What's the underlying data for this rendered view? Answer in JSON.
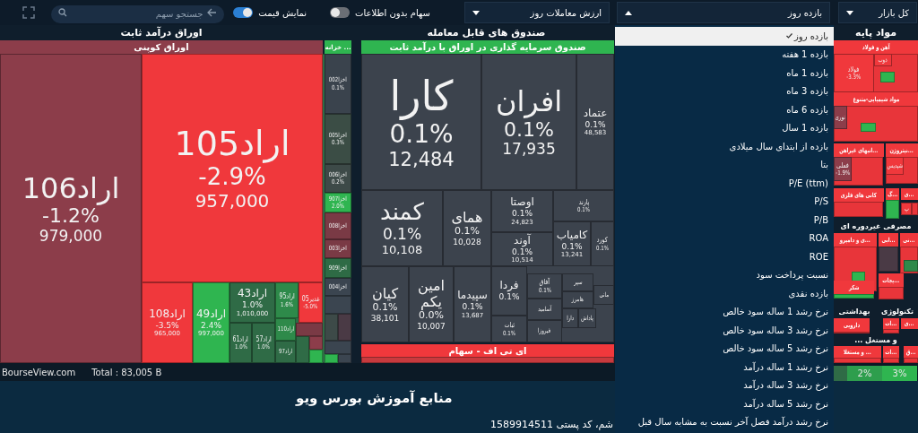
{
  "toolbar": {
    "search": {
      "placeholder": "جستجو سهم"
    },
    "toggles": [
      {
        "label": "سهام بدون اطلاعات",
        "on": false
      },
      {
        "label": "نمایش قیمت",
        "on": true
      }
    ],
    "dropdowns": [
      {
        "value": "کل بازار",
        "expanded": false
      },
      {
        "value": "بازده روز",
        "expanded": true
      },
      {
        "value": "ارزش معاملات روز",
        "expanded": false
      }
    ]
  },
  "sectors": [
    {
      "title": "مواد پایه"
    },
    {
      "title": "صندوق های قابل معامله"
    },
    {
      "title": "اوراق درآمد ثابت"
    },
    {
      "title": "مصرفی غیردوره ای"
    },
    {
      "title": "تکنولوژی"
    },
    {
      "title": "بهداشتی"
    },
    {
      "title": "... و مستغل"
    }
  ],
  "groups": [
    {
      "title": "آهن و فولاد",
      "color": "#f0383c"
    },
    {
      "title": "صندوق سرمایه گذاری در اوراق با درآمد ثابت",
      "color": "#2fb550"
    },
    {
      "title": "خزانه ...",
      "color": "#2fb550"
    },
    {
      "title": "اوراق کوپنی",
      "color": "#8c3d4a"
    },
    {
      "title": "مواد شیمیایی-متنوع",
      "color": "#f0383c"
    },
    {
      "title": "نیتروژن...",
      "color": "#f0383c"
    },
    {
      "title": "انبهای غیراهن...",
      "color": "#f0383c"
    },
    {
      "title": "ی...",
      "color": "#f0383c"
    },
    {
      "title": "گ...",
      "color": "#f0383c"
    },
    {
      "title": "کانی های فلزی",
      "color": "#f0383c"
    },
    {
      "title": "نی...",
      "color": "#f0383c"
    },
    {
      "title": "ابی...",
      "color": "#f0383c"
    },
    {
      "title": "ی و دامپرو...",
      "color": "#f0383c"
    },
    {
      "title": "یجات...",
      "color": "#f0383c"
    },
    {
      "title": "شکر",
      "color": "#f0383c"
    },
    {
      "title": "ی...",
      "color": "#f0383c"
    },
    {
      "title": "ات...",
      "color": "#f0383c"
    },
    {
      "title": "دارویی",
      "color": "#f0383c"
    },
    {
      "title": "ق...",
      "color": "#f0383c"
    },
    {
      "title": "ات...",
      "color": "#f0383c"
    },
    {
      "title": "و مستغلا ...",
      "color": "#f0383c"
    },
    {
      "title": "ای تی اف - سهام",
      "color": "#f0383c"
    }
  ],
  "tiles": [
    {
      "symbol": "ذوب",
      "color": "#f0383c"
    },
    {
      "symbol": "فولاد",
      "change": "-3.3%",
      "color": "#f0383c"
    },
    {
      "symbol": "نوری",
      "color": "#8c3d4a"
    },
    {
      "symbol": "شپدیس",
      "color": "#f0383c"
    },
    {
      "symbol": "فملی",
      "change": "-1.9%",
      "color": "#8c3d4a"
    },
    {
      "symbol": "پ",
      "color": "#f0383c"
    },
    {
      "symbol": "عتماد",
      "change": "0.1%",
      "value": "48,583",
      "color": "#3c434d"
    },
    {
      "symbol": "افران",
      "change": "0.1%",
      "value": "17,935",
      "color": "#3c434d"
    },
    {
      "symbol": "کارا",
      "change": "0.1%",
      "value": "12,484",
      "color": "#3c434d"
    },
    {
      "symbol": "پارند",
      "change": "0.1%",
      "color": "#3c434d"
    },
    {
      "symbol": "کورد",
      "change": "0.1%",
      "color": "#3c434d"
    },
    {
      "symbol": "کامیاب",
      "change": "0.1%",
      "value": "13,241",
      "color": "#3c434d"
    },
    {
      "symbol": "اوصتا",
      "change": "0.1%",
      "value": "24,823",
      "color": "#3c434d"
    },
    {
      "symbol": "آوند",
      "change": "0.1%",
      "value": "10,514",
      "color": "#3c434d"
    },
    {
      "symbol": "همای",
      "change": "0.1%",
      "value": "10,028",
      "color": "#3c434d"
    },
    {
      "symbol": "کمند",
      "change": "0.1%",
      "value": "10,108",
      "color": "#3c434d"
    },
    {
      "symbol": "مانی",
      "color": "#3c434d"
    },
    {
      "symbol": "سپر",
      "color": "#3c434d"
    },
    {
      "symbol": "هامرز",
      "color": "#3c434d"
    },
    {
      "symbol": "پاداش",
      "color": "#3c434d"
    },
    {
      "symbol": "دارا",
      "color": "#3c434d"
    },
    {
      "symbol": "آفاق",
      "change": "0.1%",
      "color": "#3c434d"
    },
    {
      "symbol": "آسامید",
      "color": "#3c434d"
    },
    {
      "symbol": "فیروزا",
      "color": "#3c434d"
    },
    {
      "symbol": "فردا",
      "change": "0.1%",
      "color": "#3c434d"
    },
    {
      "symbol": "ثبات",
      "change": "0.1%",
      "color": "#3c434d"
    },
    {
      "symbol": "سپیدما",
      "change": "0.1%",
      "value": "13,687",
      "color": "#3c434d"
    },
    {
      "symbol": "امین یکم",
      "change": "0.0%",
      "value": "10,007",
      "color": "#3c434d"
    },
    {
      "symbol": "کیان",
      "change": "0.1%",
      "value": "38,101",
      "color": "#3c434d"
    },
    {
      "symbol": "اخزا002",
      "change": "0.1%",
      "color": "#3a434d"
    },
    {
      "symbol": "اخزا005",
      "change": "0.3%",
      "color": "#3b4d45"
    },
    {
      "symbol": "اخزا006",
      "change": "0.2%",
      "color": "#3d4a48"
    },
    {
      "symbol": "اخزا907",
      "change": "2.0%",
      "color": "#2fb550"
    },
    {
      "symbol": "اخزا008",
      "color": "#7a3a45"
    },
    {
      "symbol": "اخزا003",
      "color": "#7a3a45"
    },
    {
      "symbol": "اخزا909",
      "color": "#2e6b45"
    },
    {
      "symbol": "اخزا004",
      "color": "#3b4550"
    },
    {
      "symbol": "اراد105",
      "change": "-2.9%",
      "value": "957,000",
      "color": "#f0383c"
    },
    {
      "symbol": "غدیر05",
      "change": "-5.0%",
      "color": "#f0383c"
    },
    {
      "symbol": "اراد95",
      "change": "1.6%",
      "color": "#2e8a4a"
    },
    {
      "symbol": "اراد110",
      "color": "#2e8a4a"
    },
    {
      "symbol": "اراد97",
      "color": "#2f6b46"
    },
    {
      "symbol": "اراد43",
      "change": "1.0%",
      "value": "1,010,000",
      "color": "#2f6b46"
    },
    {
      "symbol": "اراد57",
      "change": "1.0%",
      "color": "#2f6b46"
    },
    {
      "symbol": "اراد61",
      "change": "1.0%",
      "color": "#2f6b46"
    },
    {
      "symbol": "اراد49",
      "change": "2.4%",
      "value": "997,000",
      "color": "#2fb550"
    },
    {
      "symbol": "اراد108",
      "change": "-3.5%",
      "value": "965,000",
      "color": "#f0383c"
    },
    {
      "symbol": "اراد106",
      "change": "-1.2%",
      "value": "979,000",
      "color": "#8c3d4a"
    }
  ],
  "footer": {
    "site": "BourseView.com",
    "total": "Total : 83,005 B"
  },
  "legend": [
    {
      "label": "3%",
      "color": "#2fb550"
    },
    {
      "label": "2%",
      "color": "#2e9e4d"
    }
  ],
  "metric_menu": {
    "options": [
      {
        "label": "بازده روز",
        "selected": true
      },
      {
        "label": "بازده 1 هفته",
        "selected": false
      },
      {
        "label": "بازده 1 ماه",
        "selected": false
      },
      {
        "label": "بازده 3 ماه",
        "selected": false
      },
      {
        "label": "بازده 6 ماه",
        "selected": false
      },
      {
        "label": "بازده 1 سال",
        "selected": false
      },
      {
        "label": "بازده از ابتدای سال میلادی",
        "selected": false
      },
      {
        "label": "بتا",
        "selected": false
      },
      {
        "label": "P/E (ttm)",
        "selected": false
      },
      {
        "label": "P/S",
        "selected": false
      },
      {
        "label": "P/B",
        "selected": false
      },
      {
        "label": "ROA",
        "selected": false
      },
      {
        "label": "ROE",
        "selected": false
      },
      {
        "label": "نسبت پرداخت سود",
        "selected": false
      },
      {
        "label": "بازده نقدی",
        "selected": false
      },
      {
        "label": "نرخ رشد 1 ساله سود خالص",
        "selected": false
      },
      {
        "label": "نرخ رشد 3 ساله سود خالص",
        "selected": false
      },
      {
        "label": "نرخ رشد 5 ساله سود خالص",
        "selected": false
      },
      {
        "label": "نرخ رشد 1 ساله درآمد",
        "selected": false
      },
      {
        "label": "نرخ رشد 3 ساله درآمد",
        "selected": false
      },
      {
        "label": "نرخ رشد 5 ساله درآمد",
        "selected": false
      },
      {
        "label": "نرخ رشد درآمد فصل آخر نسبت به مشابه سال قبل",
        "selected": false
      }
    ]
  },
  "resources": {
    "title": "منابع آموزش بورس ویو",
    "address": "شم، کد پستی 1589914511"
  }
}
